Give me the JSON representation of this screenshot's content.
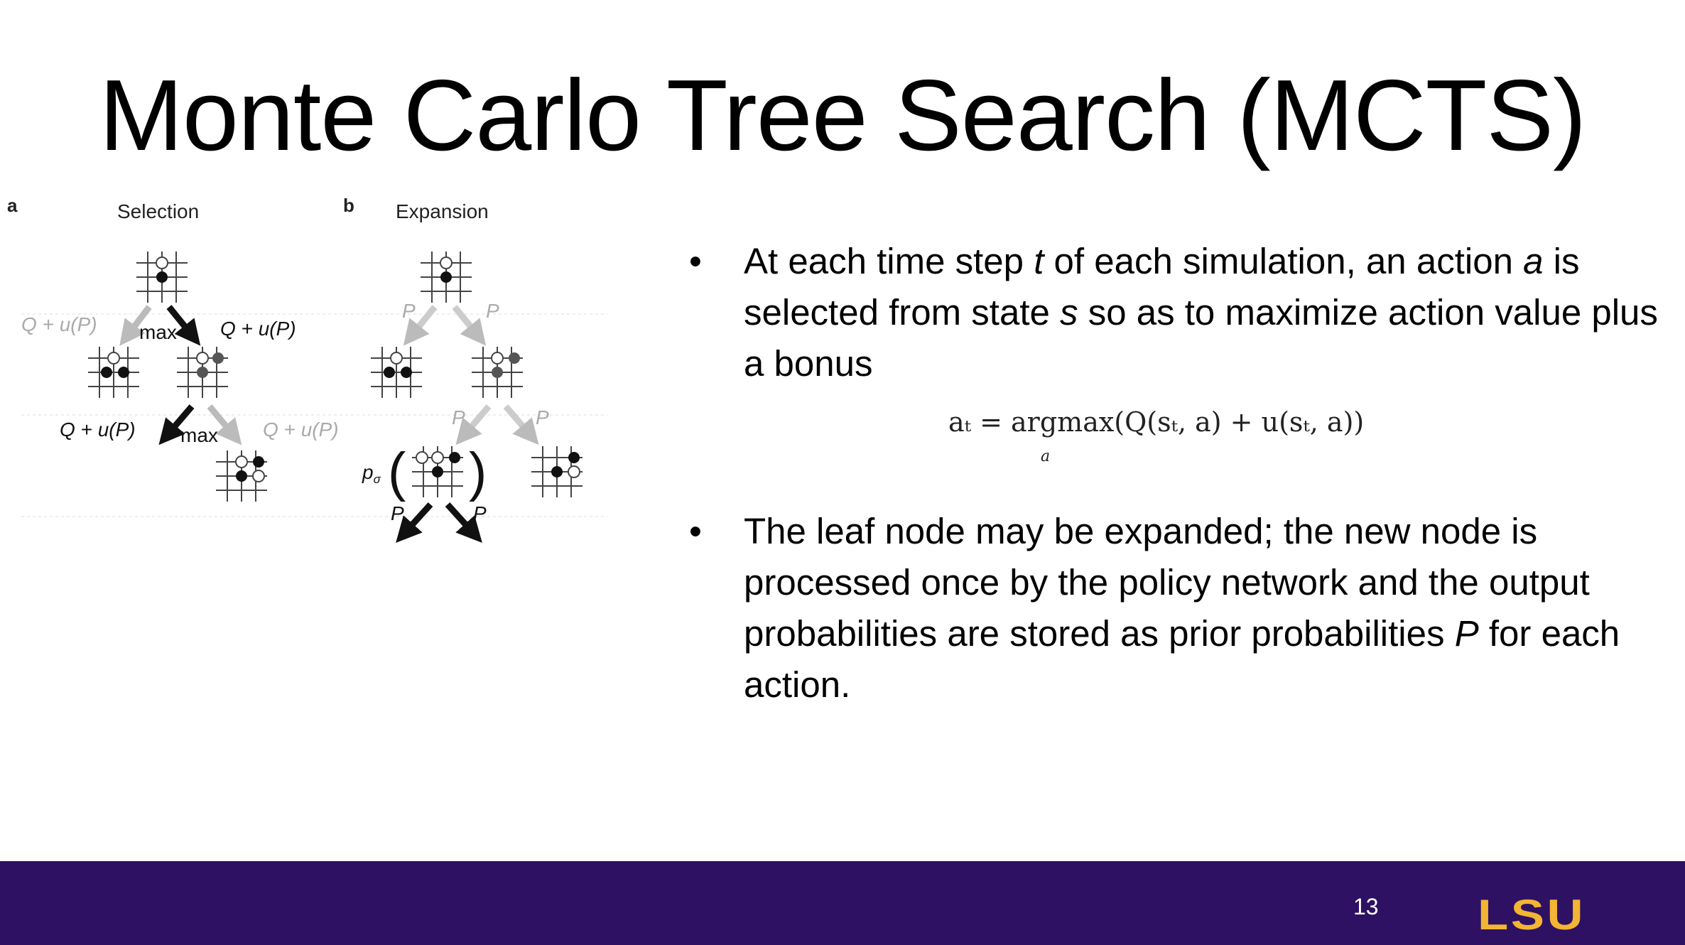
{
  "slide": {
    "title": "Monte Carlo Tree Search (MCTS)",
    "page_number": "13",
    "logo_text": "LSU"
  },
  "figure": {
    "panel_a": {
      "letter": "a",
      "title": "Selection"
    },
    "panel_b": {
      "letter": "b",
      "title": "Expansion"
    },
    "labels": {
      "q_plus_u": "Q + u(P)",
      "max": "max",
      "p": "P",
      "p_sigma": "p",
      "sigma": "σ"
    }
  },
  "bullets": {
    "b1_pre": "At each time step ",
    "b1_t": "t",
    "b1_mid": " of each simulation, an action ",
    "b1_a": "a",
    "b1_mid2": " is selected from state ",
    "b1_s": "s",
    "b1_end": " so as to maximize action value plus a bonus",
    "b2_pre": "The leaf node may be expanded; the new node is processed once by the policy network and the output probabilities are stored as prior probabilities ",
    "b2_p": "P",
    "b2_end": " for each action."
  },
  "formula": {
    "text": "aₜ = argmax(Q(sₜ, a) + u(sₜ, a))",
    "subscript": "a"
  },
  "colors": {
    "footer_bg": "#2e1162",
    "logo": "#f2b534",
    "page_number": "#ffffff"
  }
}
